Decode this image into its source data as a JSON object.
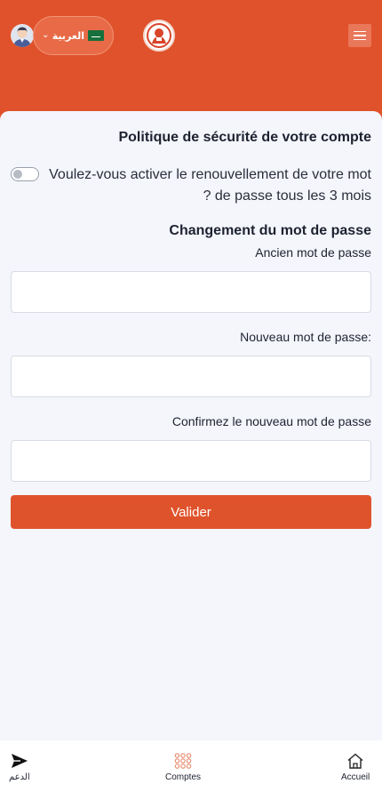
{
  "header": {
    "language_label": "العربية",
    "language_chevron": "⌄"
  },
  "icons": {
    "avatar": "user-avatar-icon",
    "flag": "saudi-flag-icon",
    "logo": "brand-logo-icon",
    "menu": "hamburger-menu-icon",
    "support": "paper-plane-icon",
    "accounts": "grid-dots-icon",
    "home": "home-icon"
  },
  "colors": {
    "brand": "#e0522b",
    "button": "#df532c",
    "background": "#f4f6fc",
    "nav_active": "#e68a6e"
  },
  "security": {
    "title": "Politique de sécurité de votre compte",
    "toggle_label": "Voulez-vous activer le renouvellement de votre mot de passe tous les 3 mois ?",
    "toggle_on": false
  },
  "password_change": {
    "title": "Changement du mot de passe",
    "old_label": "Ancien mot de passe",
    "old_value": "",
    "new_label": "Nouveau mot de passe:",
    "new_value": "",
    "confirm_label": "Confirmez le nouveau mot de passe",
    "confirm_value": "",
    "submit_label": "Valider"
  },
  "bottom_nav": {
    "support_label": "الدعم",
    "accounts_label": "Comptes",
    "home_label": "Accueil"
  }
}
